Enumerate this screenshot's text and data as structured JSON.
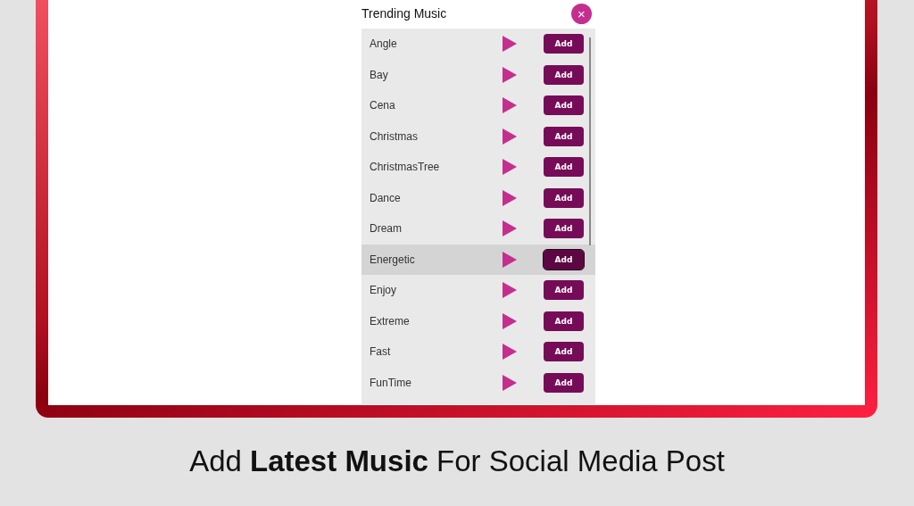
{
  "panel": {
    "title": "Trending Music",
    "close": "×"
  },
  "tracks": [
    {
      "name": "Angle",
      "button": "Add",
      "selected": false
    },
    {
      "name": "Bay",
      "button": "Add",
      "selected": false
    },
    {
      "name": "Cena",
      "button": "Add",
      "selected": false
    },
    {
      "name": "Christmas",
      "button": "Add",
      "selected": false
    },
    {
      "name": "ChristmasTree",
      "button": "Add",
      "selected": false
    },
    {
      "name": "Dance",
      "button": "Add",
      "selected": false
    },
    {
      "name": "Dream",
      "button": "Add",
      "selected": false
    },
    {
      "name": "Energetic",
      "button": "Add",
      "selected": true
    },
    {
      "name": "Enjoy",
      "button": "Add",
      "selected": false
    },
    {
      "name": "Extreme",
      "button": "Add",
      "selected": false
    },
    {
      "name": "Fast",
      "button": "Add",
      "selected": false
    },
    {
      "name": "FunTime",
      "button": "Add",
      "selected": false
    }
  ],
  "caption": "Add **Latest Music** For Social Media Post"
}
